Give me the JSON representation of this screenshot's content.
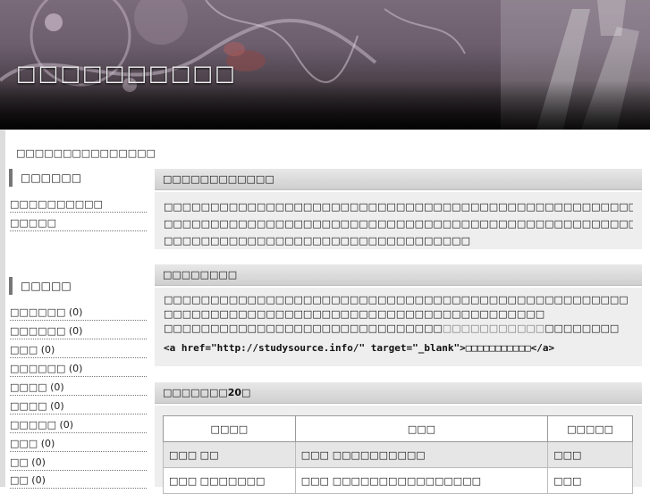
{
  "header": {
    "title": "□□□□□□□□□□"
  },
  "breadcrumb": "□□□□□□□□□□□□□□□",
  "sidebar": {
    "section1": {
      "heading": "□□□□□□",
      "links": [
        "□□□□□□□□□□",
        "□□□□□"
      ]
    },
    "section2": {
      "heading": "□□□□□",
      "items": [
        {
          "label": "□□□□□□",
          "count": "(0)"
        },
        {
          "label": "□□□□□□",
          "count": "(0)"
        },
        {
          "label": "□□□",
          "count": "(0)"
        },
        {
          "label": "□□□□□□",
          "count": "(0)"
        },
        {
          "label": "□□□□",
          "count": "(0)"
        },
        {
          "label": "□□□□",
          "count": "(0)"
        },
        {
          "label": "□□□□□",
          "count": "(0)"
        },
        {
          "label": "□□□",
          "count": "(0)"
        },
        {
          "label": "□□",
          "count": "(0)"
        },
        {
          "label": "□□",
          "count": "(0)"
        }
      ]
    }
  },
  "main": {
    "panel1": {
      "title": "□□□□□□□□□□□□",
      "lines": [
        "□□□□□□□□□□□□□□□□□□□□□□□□□□□□□□□□□□□□□□□□□□□□□□□□□□□□□□□□□□□□□□□□□□□□□□□□",
        "□□□□□□□□□□□□□□□□□□□□□□□□□□□□□□□□□□□□□□□□□□□□□□□□□□□□□□□□□□□□□□□□□□□□□□□□",
        "□□□□□□□□□□□□□□□□□□□□□□□□□□□□□□□□□"
      ]
    },
    "panel2": {
      "title": "□□□□□□□□",
      "line1": "□□□□□□□□□□□□□□□□□□□□□□□□□□□□□□□□□□□□□□□□□□□□□□□□□□",
      "line2": "□□□□□□□□□□□□□□□□□□□□□□□□□□□□□□□□□□□□□□□□□",
      "line3_pre": "□□□□□□□□□□□□□□□□□□□□□□□□□□□□□□",
      "line3_link": "□□□□□□□□□□□",
      "line3_post": "□□□□□□□□",
      "code_pre": "<a href=\"http://studysource.info/\" target=\"_blank\">",
      "code_text": "□□□□□□□□□□□",
      "code_post": "</a>"
    },
    "panel3": {
      "title": "□□□□□□□20□"
    },
    "table": {
      "headers": [
        "□□□□",
        "□□□",
        "□□□□□"
      ],
      "rows": [
        [
          "□□□ □□",
          "□□□ □□□□□□□□□□",
          "□□□"
        ],
        [
          "□□□ □□□□□□□",
          "□□□ □□□□□□□□□□□□□□□□",
          "□□□"
        ]
      ]
    }
  }
}
